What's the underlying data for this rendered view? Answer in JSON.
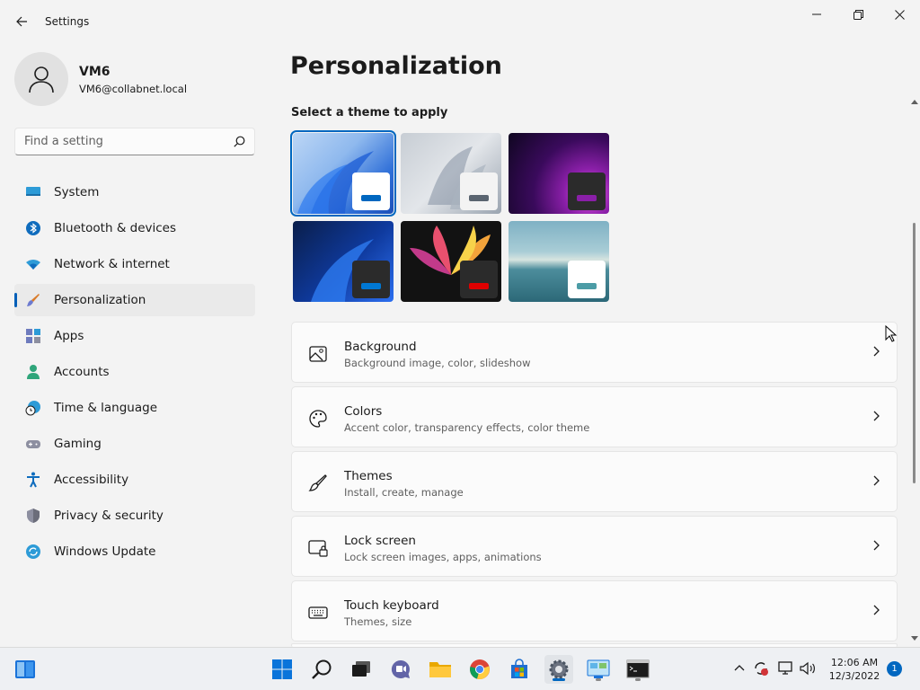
{
  "window": {
    "title": "Settings"
  },
  "user": {
    "name": "VM6",
    "email": "VM6@collabnet.local"
  },
  "search": {
    "placeholder": "Find a setting"
  },
  "nav": [
    {
      "label": "System",
      "icon": "system-icon"
    },
    {
      "label": "Bluetooth & devices",
      "icon": "bluetooth-icon"
    },
    {
      "label": "Network & internet",
      "icon": "wifi-icon"
    },
    {
      "label": "Personalization",
      "icon": "brush-icon",
      "active": true
    },
    {
      "label": "Apps",
      "icon": "apps-icon"
    },
    {
      "label": "Accounts",
      "icon": "accounts-icon"
    },
    {
      "label": "Time & language",
      "icon": "clock-globe-icon"
    },
    {
      "label": "Gaming",
      "icon": "gamepad-icon"
    },
    {
      "label": "Accessibility",
      "icon": "accessibility-icon"
    },
    {
      "label": "Privacy & security",
      "icon": "shield-icon"
    },
    {
      "label": "Windows Update",
      "icon": "update-icon"
    }
  ],
  "main": {
    "title": "Personalization",
    "themes_label": "Select a theme to apply",
    "themes": [
      {
        "name": "windows-light-theme",
        "accent": "#0067c0",
        "selected": true
      },
      {
        "name": "glow-theme",
        "accent": "#5a6470"
      },
      {
        "name": "captured-motion-theme",
        "accent": "#8a1fa8"
      },
      {
        "name": "windows-dark-theme",
        "accent": "#0078d4"
      },
      {
        "name": "flow-theme",
        "accent": "#e00000"
      },
      {
        "name": "sunrise-theme",
        "accent": "#4c9ca6"
      }
    ],
    "cards": [
      {
        "title": "Background",
        "subtitle": "Background image, color, slideshow",
        "icon": "image-icon"
      },
      {
        "title": "Colors",
        "subtitle": "Accent color, transparency effects, color theme",
        "icon": "palette-icon"
      },
      {
        "title": "Themes",
        "subtitle": "Install, create, manage",
        "icon": "brush-icon"
      },
      {
        "title": "Lock screen",
        "subtitle": "Lock screen images, apps, animations",
        "icon": "lock-screen-icon"
      },
      {
        "title": "Touch keyboard",
        "subtitle": "Themes, size",
        "icon": "keyboard-icon"
      }
    ]
  },
  "taskbar": {
    "time": "12:06 AM",
    "date": "12/3/2022",
    "notification_count": "1"
  },
  "colors": {
    "accent": "#0067c0"
  }
}
